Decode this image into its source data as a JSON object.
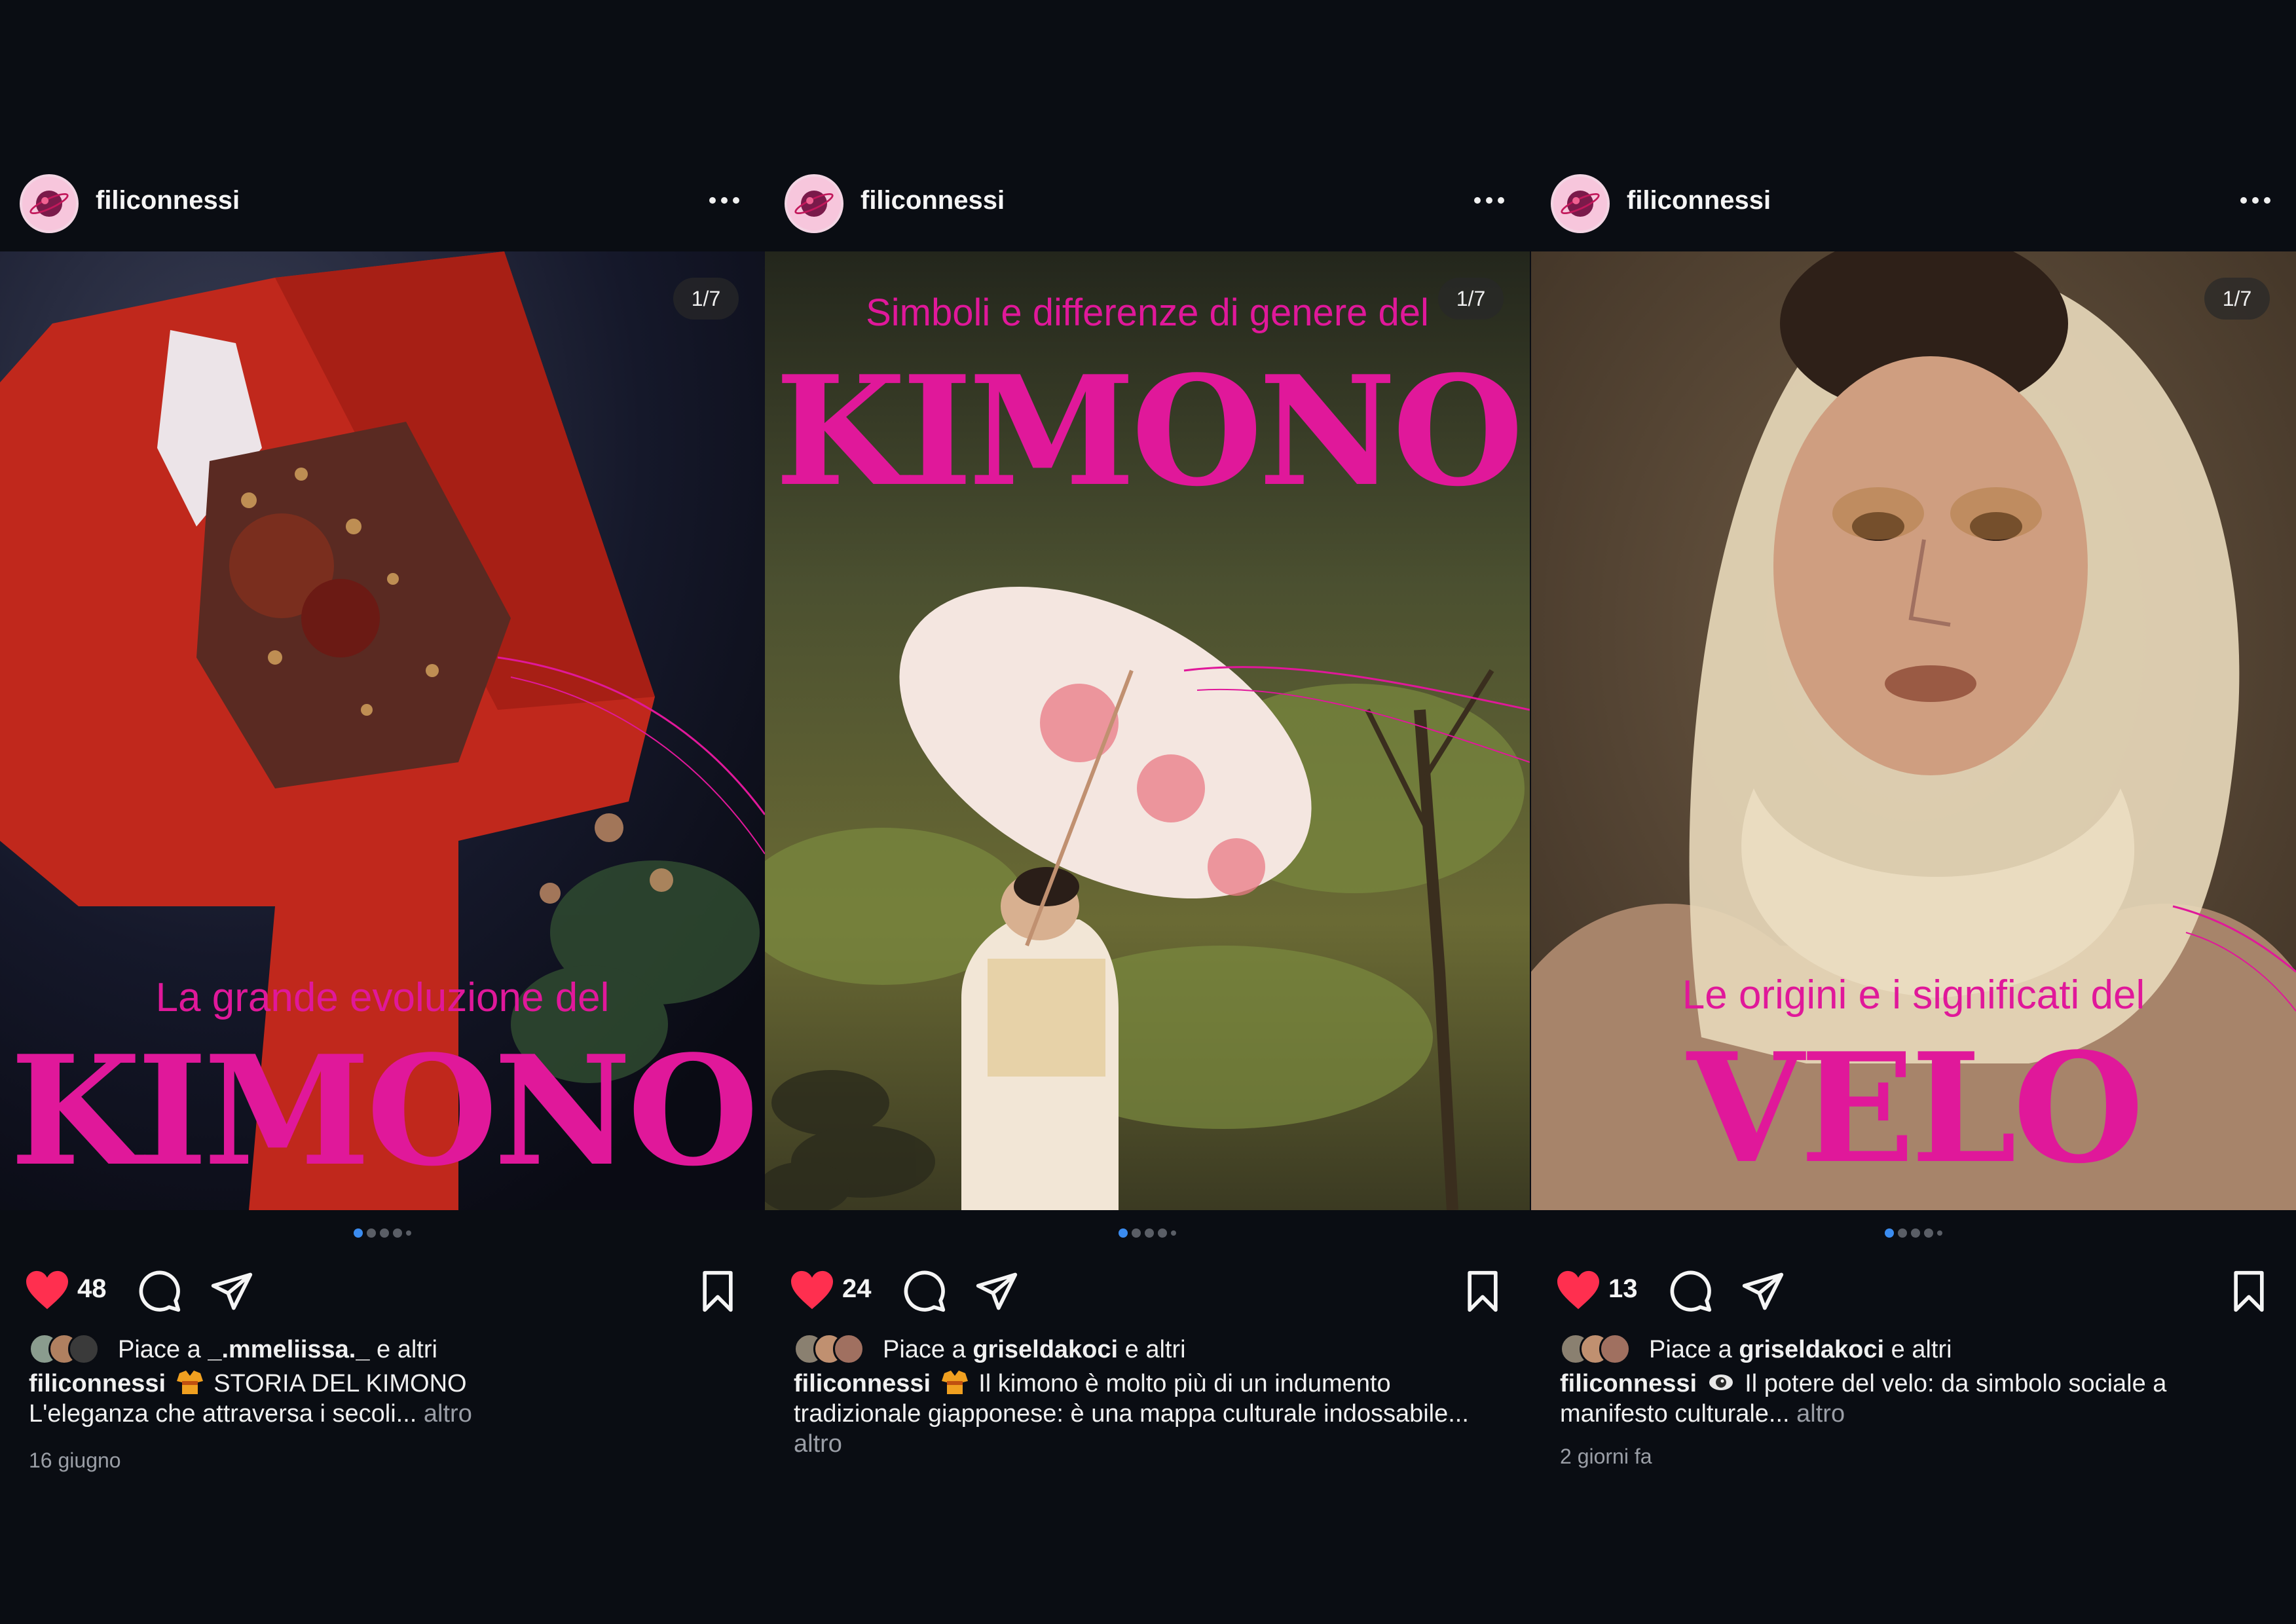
{
  "accent": "#e0189a",
  "posts": [
    {
      "username": "filiconnessi",
      "counter": "1/7",
      "subtitle": "La grande evoluzione del",
      "title": "KIMONO",
      "like_count": "48",
      "likes_prefix": "Piace a ",
      "likes_user": "_.mmeliissa._",
      "likes_suffix": " e altri",
      "caption_user": "filiconnessi",
      "caption_emoji": "kimono-emoji",
      "caption_text": "STORIA DEL KIMONO",
      "caption_line2": "L'eleganza che attraversa i secoli...",
      "caption_more": "altro",
      "date": "16 giugno"
    },
    {
      "username": "filiconnessi",
      "counter": "1/7",
      "subtitle": "Simboli e differenze di genere del",
      "title": "KIMONO",
      "like_count": "24",
      "likes_prefix": "Piace a ",
      "likes_user": "griseldakoci",
      "likes_suffix": " e altri",
      "caption_user": "filiconnessi",
      "caption_emoji": "kimono-emoji",
      "caption_text": "Il kimono è molto più di un indumento tradizionale giapponese: è una mappa culturale indossabile...",
      "caption_more": "altro",
      "date": ""
    },
    {
      "username": "filiconnessi",
      "counter": "1/7",
      "subtitle": "Le origini e i significati del",
      "title": "VELO",
      "like_count": "13",
      "likes_prefix": "Piace a ",
      "likes_user": "griseldakoci",
      "likes_suffix": " e altri",
      "caption_user": "filiconnessi",
      "caption_emoji": "eye-emoji",
      "caption_text": "Il potere del velo: da simbolo sociale a manifesto culturale...",
      "caption_more": "altro",
      "date": "2 giorni fa"
    }
  ]
}
